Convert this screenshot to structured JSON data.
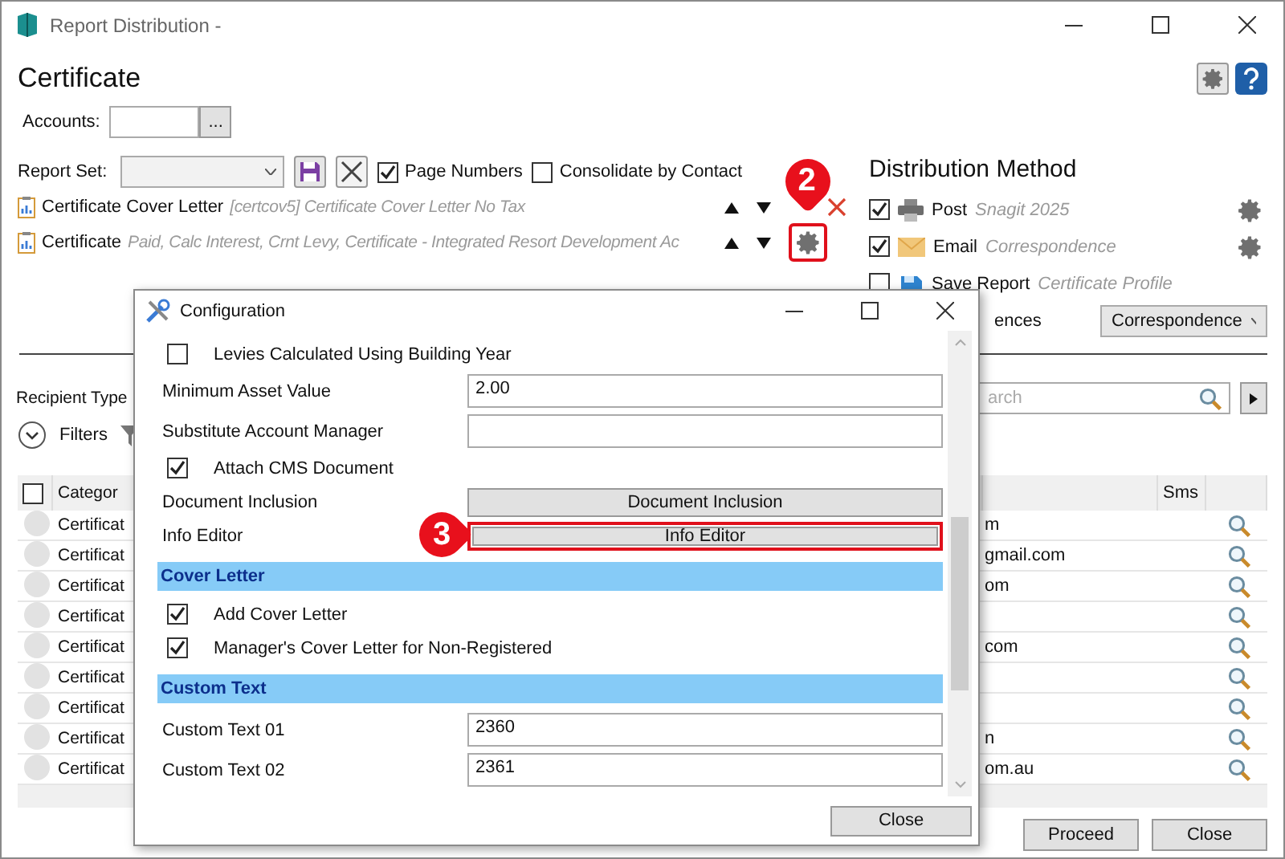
{
  "window": {
    "title": "Report Distribution -"
  },
  "header": {
    "title": "Certificate"
  },
  "accounts": {
    "label": "Accounts:",
    "browse": "..."
  },
  "report_set": {
    "label": "Report Set:",
    "options": [
      {
        "label": "Page Numbers",
        "checked": true
      },
      {
        "label": "Consolidate by Contact",
        "checked": false
      }
    ]
  },
  "reports": [
    {
      "name": "Certificate Cover Letter",
      "description": "[certcov5] Certificate Cover Letter No Tax",
      "kind": "delete"
    },
    {
      "name": "Certificate",
      "description": "Paid, Calc Interest, Crnt Levy, Certificate - Integrated Resort Development Ac",
      "kind": "settings",
      "highlighted": true,
      "callout": "2"
    }
  ],
  "distribution": {
    "title": "Distribution Method",
    "methods": [
      {
        "name": "Post",
        "detail": "Snagit 2025",
        "checked": true,
        "kind": "printer",
        "settings": true
      },
      {
        "name": "Email",
        "detail": "Correspondence",
        "checked": true,
        "kind": "envelope",
        "settings": true
      },
      {
        "name": "Save Report",
        "detail": "Certificate Profile",
        "checked": false,
        "kind": "save",
        "settings": false
      }
    ],
    "preferences": {
      "label": "ences",
      "value": "Correspondence"
    }
  },
  "recipients": {
    "label": "Recipient Type",
    "search_placeholder": "arch",
    "filters": "Filters"
  },
  "table": {
    "select_all_checked": false,
    "columns": [
      "Categor",
      "Sms"
    ],
    "rows": [
      {
        "category": "Certificat",
        "email": "m"
      },
      {
        "category": "Certificat",
        "email": "gmail.com"
      },
      {
        "category": "Certificat",
        "email": "om"
      },
      {
        "category": "Certificat"
      },
      {
        "category": "Certificat",
        "email": "com"
      },
      {
        "category": "Certificat"
      },
      {
        "category": "Certificat"
      },
      {
        "category": "Certificat",
        "email": "n"
      },
      {
        "category": "Certificat",
        "email": "om.au"
      }
    ]
  },
  "buttons": [
    "Proceed",
    "Close"
  ],
  "dialog": {
    "title": "Configuration",
    "items": [
      {
        "kind": "checkbox",
        "label": "Levies Calculated Using Building Year",
        "checked": false
      },
      {
        "kind": "field",
        "label": "Minimum Asset Value",
        "value": "2.00"
      },
      {
        "kind": "field",
        "label": "Substitute Account Manager"
      },
      {
        "kind": "checkbox",
        "label": "Attach CMS Document",
        "checked": true
      },
      {
        "kind": "button",
        "label": "Document Inclusion",
        "button": "Document Inclusion",
        "highlighted": false
      },
      {
        "kind": "button",
        "label": "Info Editor",
        "button": "Info Editor",
        "highlighted": true,
        "callout": "3"
      },
      {
        "kind": "section",
        "label": "Cover Letter"
      },
      {
        "kind": "checkbox",
        "label": "Add Cover Letter",
        "checked": true
      },
      {
        "kind": "checkbox",
        "label": "Manager's Cover Letter for Non-Registered",
        "checked": true
      },
      {
        "kind": "section",
        "label": "Custom Text"
      },
      {
        "kind": "field",
        "label": "Custom Text 01",
        "value": "2360"
      },
      {
        "kind": "field",
        "label": "Custom Text 02",
        "value": "2361"
      }
    ],
    "close": "Close"
  }
}
